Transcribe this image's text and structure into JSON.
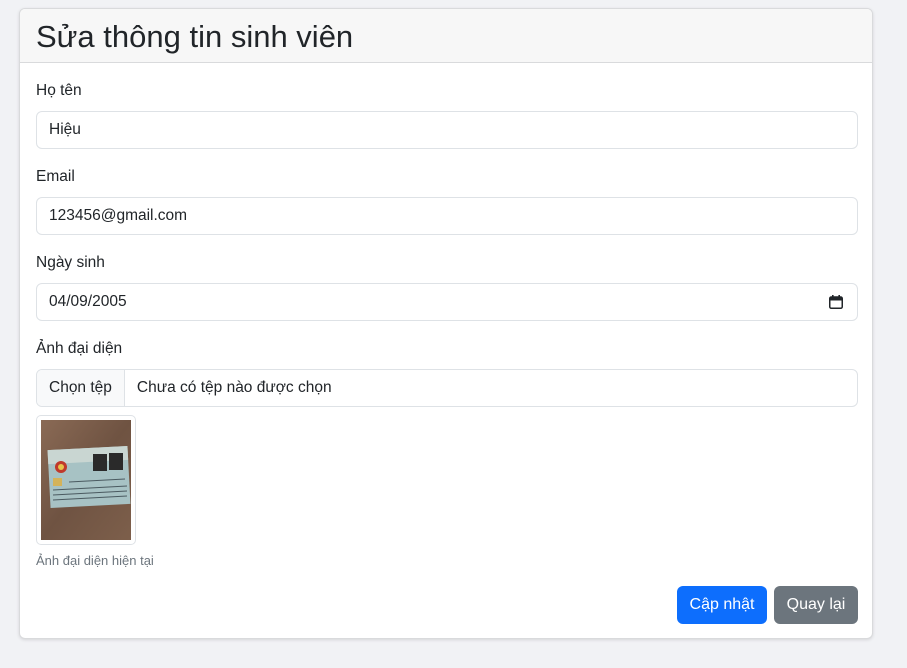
{
  "page": {
    "title": "Sửa thông tin sinh viên"
  },
  "form": {
    "name": {
      "label": "Họ tên",
      "value": "Hiệu"
    },
    "email": {
      "label": "Email",
      "value": "123456@gmail.com"
    },
    "dob": {
      "label": "Ngày sinh",
      "value": "04/09/2005",
      "icon": "calendar-icon"
    },
    "avatar": {
      "label": "Ảnh đại diện",
      "button_label": "Chọn tệp",
      "status": "Chưa có tệp nào được chọn",
      "caption": "Ảnh đại diện hiện tại"
    }
  },
  "actions": {
    "update_label": "Cập nhật",
    "back_label": "Quay lại"
  },
  "colors": {
    "primary": "#0d6efd",
    "secondary": "#6c757d",
    "page_bg": "#f1f2f5",
    "header_bg": "#f7f7f7"
  }
}
